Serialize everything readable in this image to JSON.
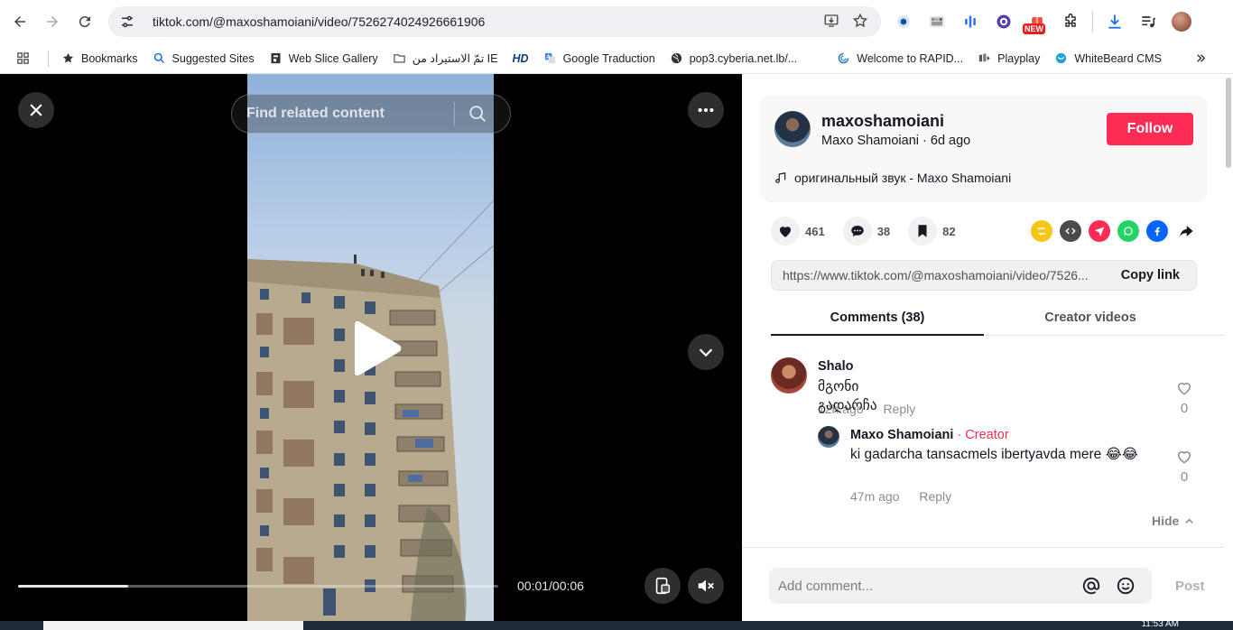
{
  "browser": {
    "url": "tiktok.com/@maxoshamoiani/video/7526274024926661906",
    "bookmarks": [
      {
        "label": "Bookmarks",
        "icon": "star-icon"
      },
      {
        "label": "Suggested Sites",
        "icon": "search-icon"
      },
      {
        "label": "Web Slice Gallery",
        "icon": "web-slice-icon"
      },
      {
        "label": "تمّ الاستيراد من IE",
        "icon": "folder-icon"
      },
      {
        "label": "HD",
        "icon": "hd-icon"
      },
      {
        "label": "Google Traduction",
        "icon": "google-translate-icon"
      },
      {
        "label": "pop3.cyberia.net.lb/...",
        "icon": "globe-icon"
      },
      {
        "label": "Welcome to RAPID...",
        "icon": "rapid-icon"
      },
      {
        "label": "Playplay",
        "icon": "playplay-icon"
      },
      {
        "label": "WhiteBeard CMS",
        "icon": "whitebeard-icon"
      }
    ],
    "ext_badge": "NEW"
  },
  "video": {
    "search_placeholder": "Find related content",
    "time": "00:01/00:06",
    "progress": 0.23
  },
  "author": {
    "handle": "maxoshamoiani",
    "subtitle": "Maxo Shamoiani · 6d ago",
    "follow_label": "Follow",
    "music": "оригинальный звук - Maxo Shamoiani"
  },
  "stats": {
    "likes": "461",
    "comments": "38",
    "saves": "82"
  },
  "share_colors": {
    "repost": "#f5c518",
    "embed": "#4b4b4b",
    "send": "#fe2c55",
    "whatsapp": "#25d366",
    "facebook": "#0866ff"
  },
  "link": {
    "url": "https://www.tiktok.com/@maxoshamoiani/video/7526...",
    "copy_label": "Copy link"
  },
  "tabs": [
    "Comments (38)",
    "Creator videos"
  ],
  "comments": [
    {
      "user": "Shalo",
      "text": "მგონი გადარჩა",
      "time": "12h ago",
      "reply": "Reply",
      "likes": "0"
    }
  ],
  "replies": [
    {
      "user": "Maxo Shamoiani",
      "badge": " · Creator",
      "text": "ki gadarcha tansacmels ibertyavda mere 😂😂",
      "time": "47m ago",
      "reply": "Reply",
      "likes": "0"
    }
  ],
  "hide_label": "Hide",
  "composer": {
    "placeholder": "Add comment...",
    "post_label": "Post"
  },
  "taskbar_time": "11:53 AM"
}
